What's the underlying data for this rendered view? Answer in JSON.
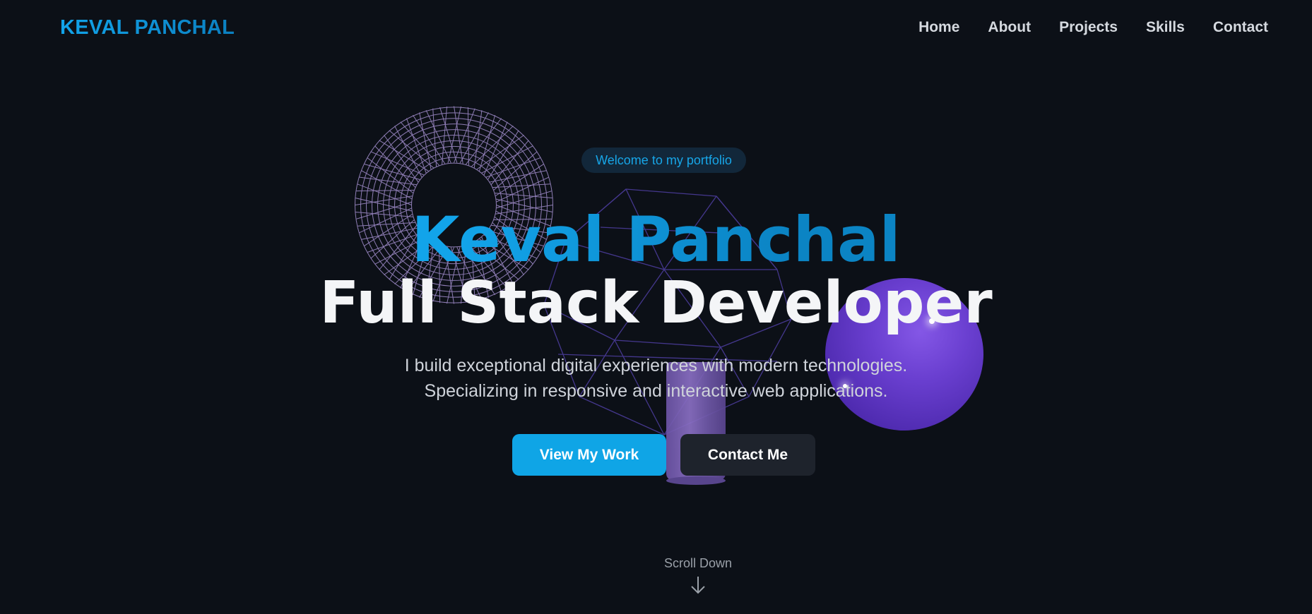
{
  "nav": {
    "logo": "KEVAL PANCHAL",
    "links": [
      "Home",
      "About",
      "Projects",
      "Skills",
      "Contact"
    ]
  },
  "hero": {
    "badge": "Welcome to my portfolio",
    "name": "Keval Panchal",
    "role": "Full Stack Developer",
    "description_line1": "I build exceptional digital experiences with modern technologies.",
    "description_line2": "Specializing in responsive and interactive web applications.",
    "primary_button": "View My Work",
    "secondary_button": "Contact Me"
  },
  "scroll": {
    "label": "Scroll Down",
    "icon": "arrow-down-icon"
  },
  "colors": {
    "background": "#0c1017",
    "accent": "#0fa5e6",
    "decor_purple": "#6a3fd0"
  }
}
